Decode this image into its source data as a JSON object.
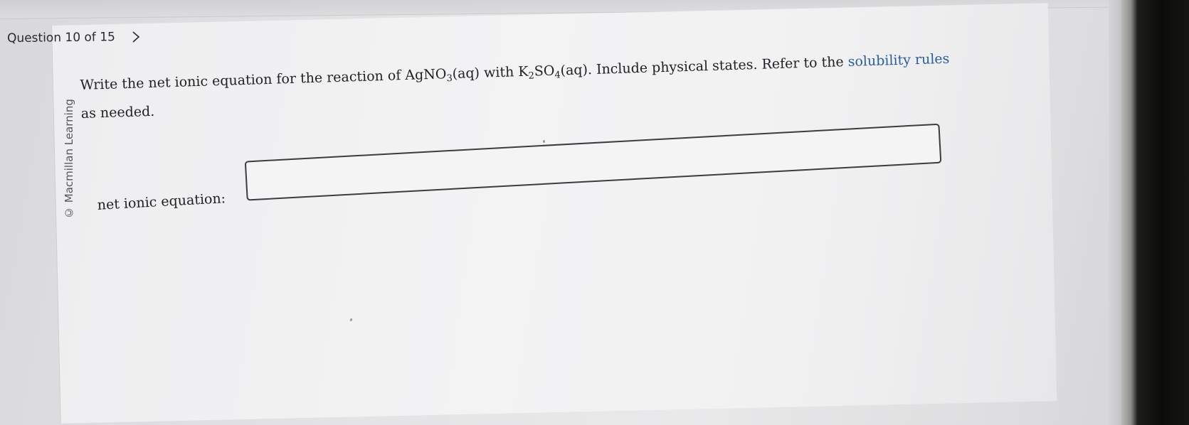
{
  "header": {
    "question_counter": "Question 10 of 15"
  },
  "copyright": "© Macmillan Learning",
  "question": {
    "text_1": "Write the net ionic equation for the reaction of ",
    "reactant_1": {
      "base": "AgNO",
      "sub": "3",
      "state": "(aq)"
    },
    "text_2": " with ",
    "reactant_2": {
      "base1": "K",
      "sub1": "2",
      "base2": "SO",
      "sub2": "4",
      "state": "(aq)"
    },
    "text_3": ". Include physical states. Refer to the ",
    "link": "solubility rules",
    "text_4": " as needed."
  },
  "answer": {
    "label": "net ionic equation:",
    "value": ""
  },
  "colors": {
    "link": "#2a5d9a",
    "text": "#1f1f24",
    "input_border": "#3b3b42"
  },
  "icons": {
    "next": "chevron-right-icon"
  }
}
